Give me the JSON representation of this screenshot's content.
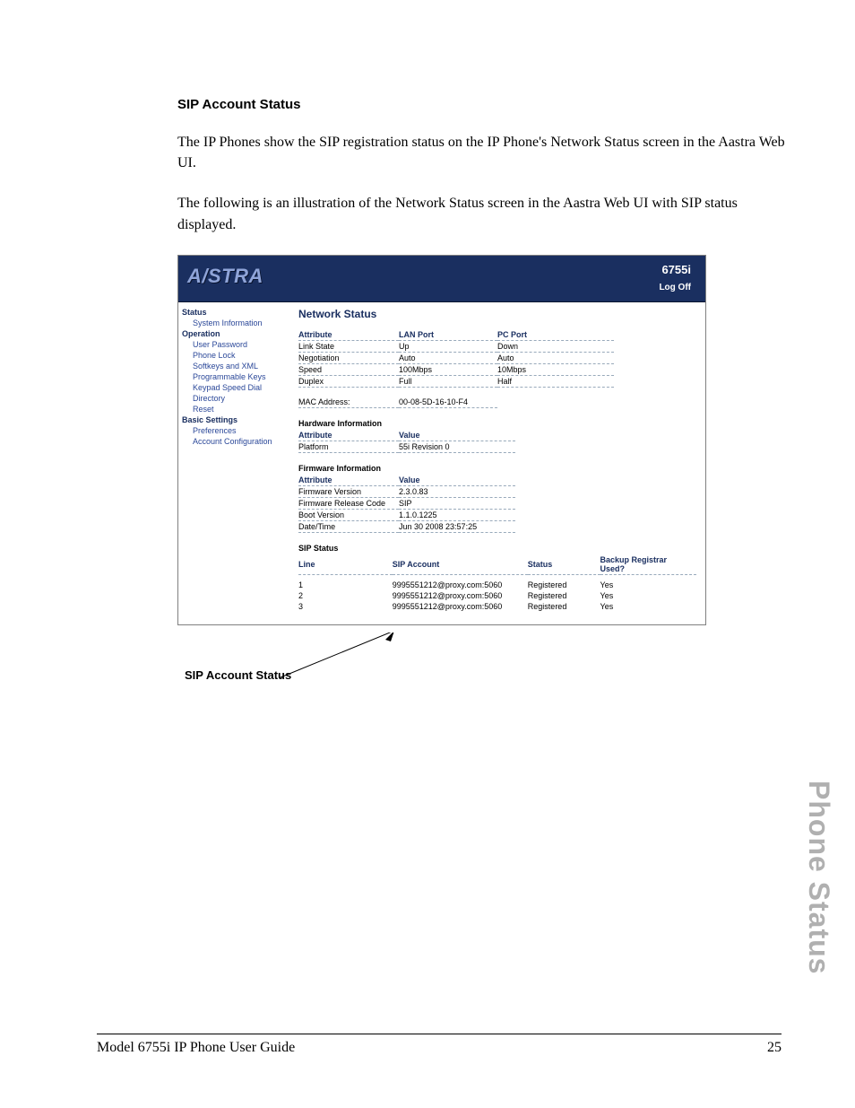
{
  "section_heading": "SIP Account Status",
  "para1": "The IP Phones show the SIP registration status on the IP Phone's Network Status screen in the Aastra Web UI.",
  "para2": "The following is an illustration of the Network Status screen in the Aastra Web UI with SIP status displayed.",
  "shot": {
    "brand": "A/STRA",
    "model": "6755i",
    "logoff": "Log Off",
    "sidebar": {
      "g1": "Status",
      "g1_items": [
        "System Information"
      ],
      "g2": "Operation",
      "g2_items": [
        "User Password",
        "Phone Lock",
        "Softkeys and XML",
        "Programmable Keys",
        "Keypad Speed Dial",
        "Directory",
        "Reset"
      ],
      "g3": "Basic Settings",
      "g3_items": [
        "Preferences",
        "Account Configuration"
      ]
    },
    "content": {
      "title": "Network Status",
      "net_headers": [
        "Attribute",
        "LAN Port",
        "PC Port"
      ],
      "net_rows": [
        [
          "Link State",
          "Up",
          "Down"
        ],
        [
          "Negotiation",
          "Auto",
          "Auto"
        ],
        [
          "Speed",
          "100Mbps",
          "10Mbps"
        ],
        [
          "Duplex",
          "Full",
          "Half"
        ]
      ],
      "mac_label": "MAC Address:",
      "mac_value": "00-08-5D-16-10-F4",
      "hw_section": "Hardware Information",
      "hw_headers": [
        "Attribute",
        "Value"
      ],
      "hw_rows": [
        [
          "Platform",
          "55i Revision 0"
        ]
      ],
      "fw_section": "Firmware Information",
      "fw_headers": [
        "Attribute",
        "Value"
      ],
      "fw_rows": [
        [
          "Firmware Version",
          "2.3.0.83"
        ],
        [
          "Firmware Release Code",
          "SIP"
        ],
        [
          "Boot Version",
          "1.1.0.1225"
        ],
        [
          "Date/Time",
          "Jun 30 2008 23:57:25"
        ]
      ],
      "sip_section": "SIP Status",
      "sip_headers": [
        "Line",
        "SIP Account",
        "Status",
        "Backup Registrar Used?"
      ],
      "sip_rows": [
        [
          "1",
          "9995551212@proxy.com:5060",
          "Registered",
          "Yes"
        ],
        [
          "2",
          "9995551212@proxy.com:5060",
          "Registered",
          "Yes"
        ],
        [
          "3",
          "9995551212@proxy.com:5060",
          "Registered",
          "Yes"
        ]
      ]
    }
  },
  "callout_label": "SIP Account Status",
  "side_tab": "Phone Status",
  "footer_left": "Model 6755i IP Phone User Guide",
  "footer_right": "25"
}
